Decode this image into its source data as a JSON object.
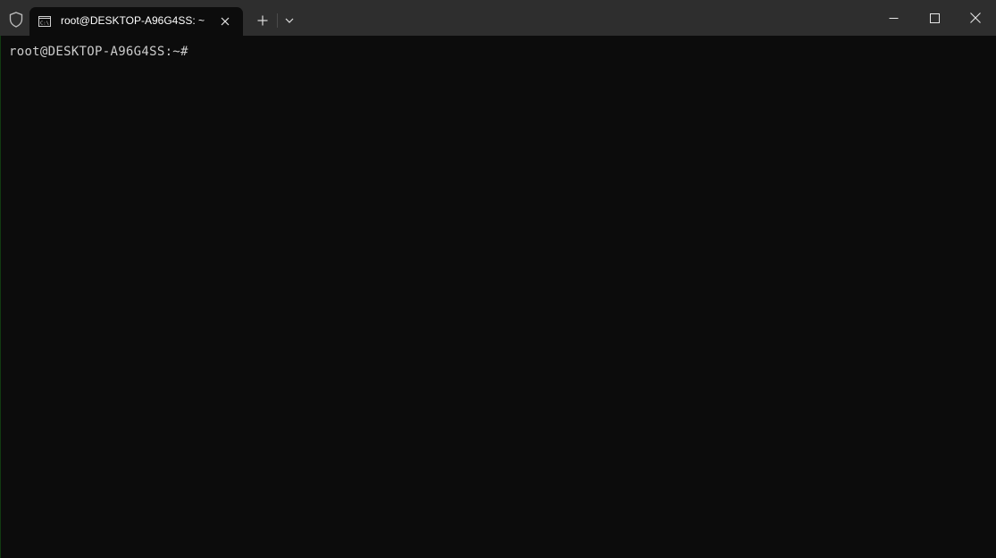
{
  "window": {
    "tab_title": "root@DESKTOP-A96G4SS: ~",
    "tab_icon": "terminal-prompt-icon",
    "shield_icon": "shield-icon"
  },
  "terminal": {
    "prompt": "root@DESKTOP-A96G4SS:~#"
  },
  "colors": {
    "titlebar": "#2e2e2e",
    "background": "#0c0c0c",
    "text": "#cccccc"
  }
}
